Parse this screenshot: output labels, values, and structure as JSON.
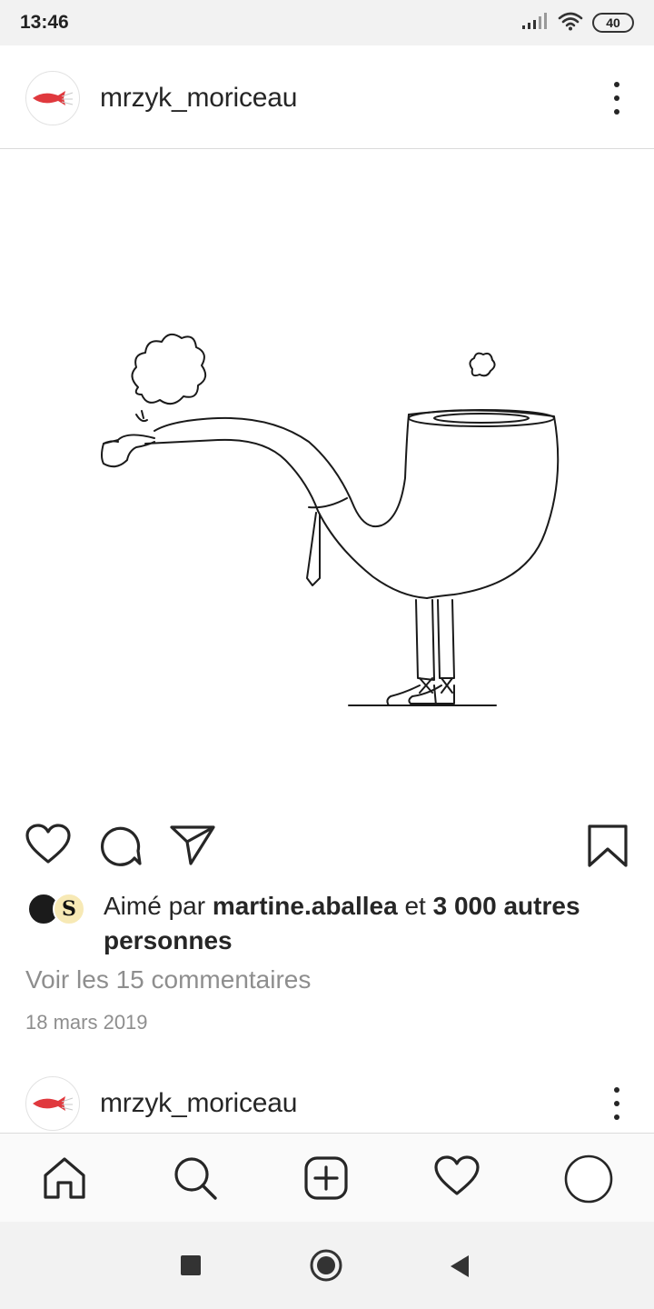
{
  "status_bar": {
    "time": "13:46",
    "battery": "40",
    "icons": [
      "signal-icon",
      "wifi-icon",
      "battery-icon"
    ]
  },
  "post": {
    "username": "mrzyk_moriceau",
    "avatar_icon": "fish-logo-icon",
    "more_icon": "more-vertical-icon",
    "image_description_icon": "pipe-man-drawing",
    "actions": {
      "like_icon": "heart-icon",
      "comment_icon": "comment-icon",
      "share_icon": "send-icon",
      "save_icon": "bookmark-icon"
    },
    "likes": {
      "prefix": "Aimé par ",
      "user": "martine.aballea",
      "middle": " et ",
      "count": "3 000 autres personnes"
    },
    "comments_link": "Voir les 15 commentaires",
    "date": "18 mars 2019"
  },
  "next_post": {
    "username": "mrzyk_moriceau"
  },
  "bottom_nav": {
    "items": [
      "home-icon",
      "search-icon",
      "add-post-icon",
      "activity-heart-icon",
      "profile-icon"
    ]
  },
  "system_nav": {
    "items": [
      "recents-button",
      "home-button",
      "back-button"
    ]
  },
  "colors": {
    "text": "#262626",
    "secondary": "#8e8e8e",
    "fish": "#e0393e",
    "divider": "#dbdbdb"
  }
}
